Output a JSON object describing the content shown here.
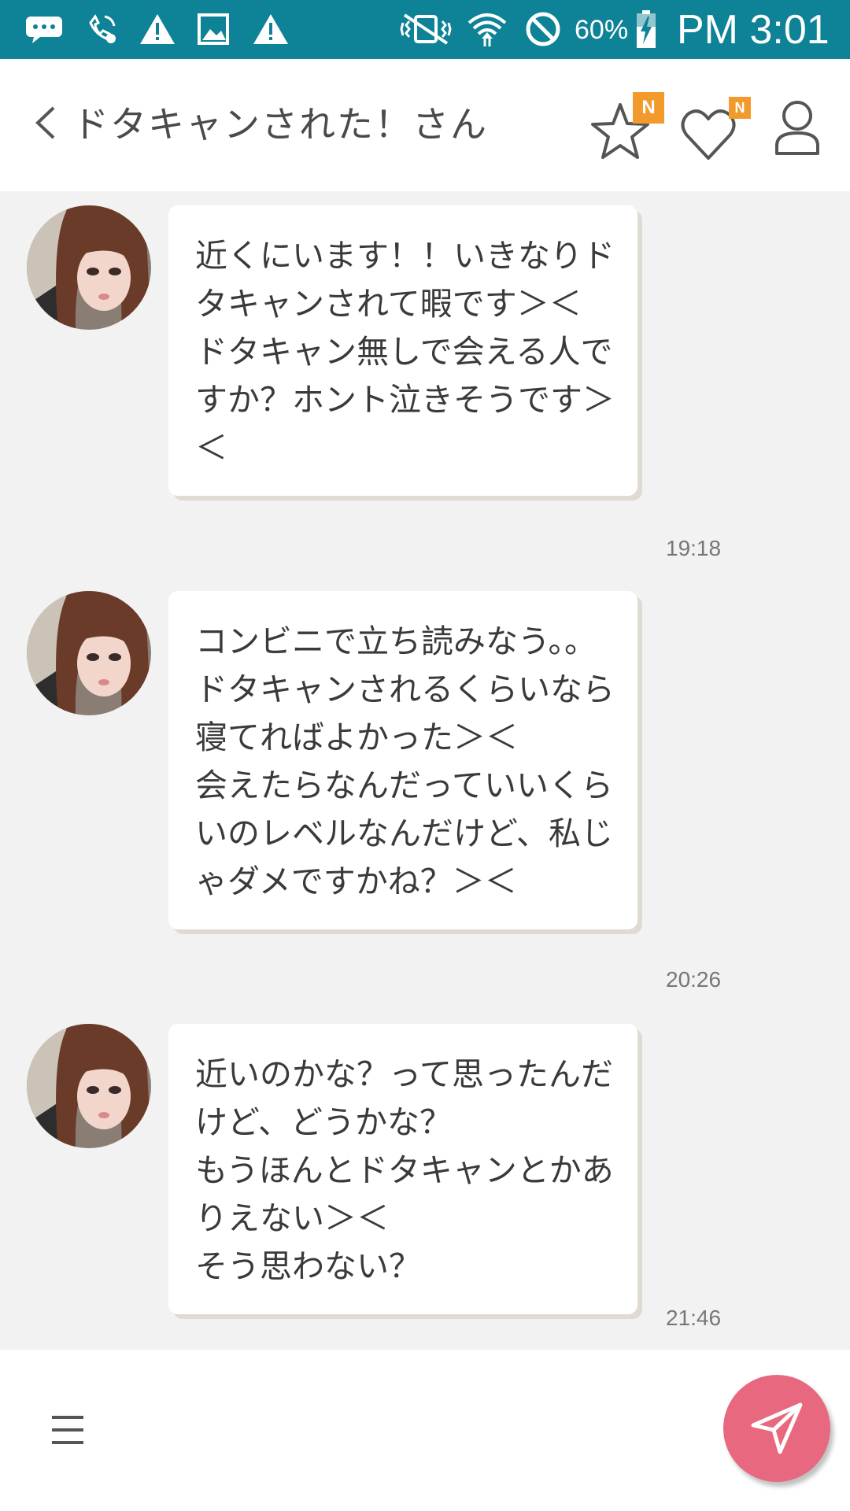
{
  "status_bar": {
    "battery_percent": "60%",
    "time": "PM 3:01",
    "background_color": "#0e8296",
    "icons": [
      "message-icon",
      "wifi-calling-icon",
      "warning-icon",
      "image-icon",
      "warning-icon",
      "vibrate-icon",
      "wifi-icon",
      "block-icon",
      "battery-charging-icon"
    ]
  },
  "header": {
    "title": "ドタキャンされた！さん",
    "favorite_badge": "N",
    "like_badge": "N",
    "accent_color": "#f39a2c"
  },
  "messages": [
    {
      "text": "近くにいます！！いきなりドタキャンされて暇です＞＜\nドタキャン無しで会える人ですか？ホント泣きそうです＞＜",
      "time": "19:18"
    },
    {
      "text": "コンビニで立ち読みなう。。\nドタキャンされるくらいなら寝てればよかった＞＜\n会えたらなんだっていいくらいのレベルなんだけど、私じゃダメですかね？＞＜",
      "time": "20:26"
    },
    {
      "text": "近いのかな？って思ったんだけど、どうかな？\nもうほんとドタキャンとかありえない＞＜\nそう思わない？",
      "time": "21:46"
    }
  ],
  "footer": {
    "send_color": "#e8697f"
  }
}
